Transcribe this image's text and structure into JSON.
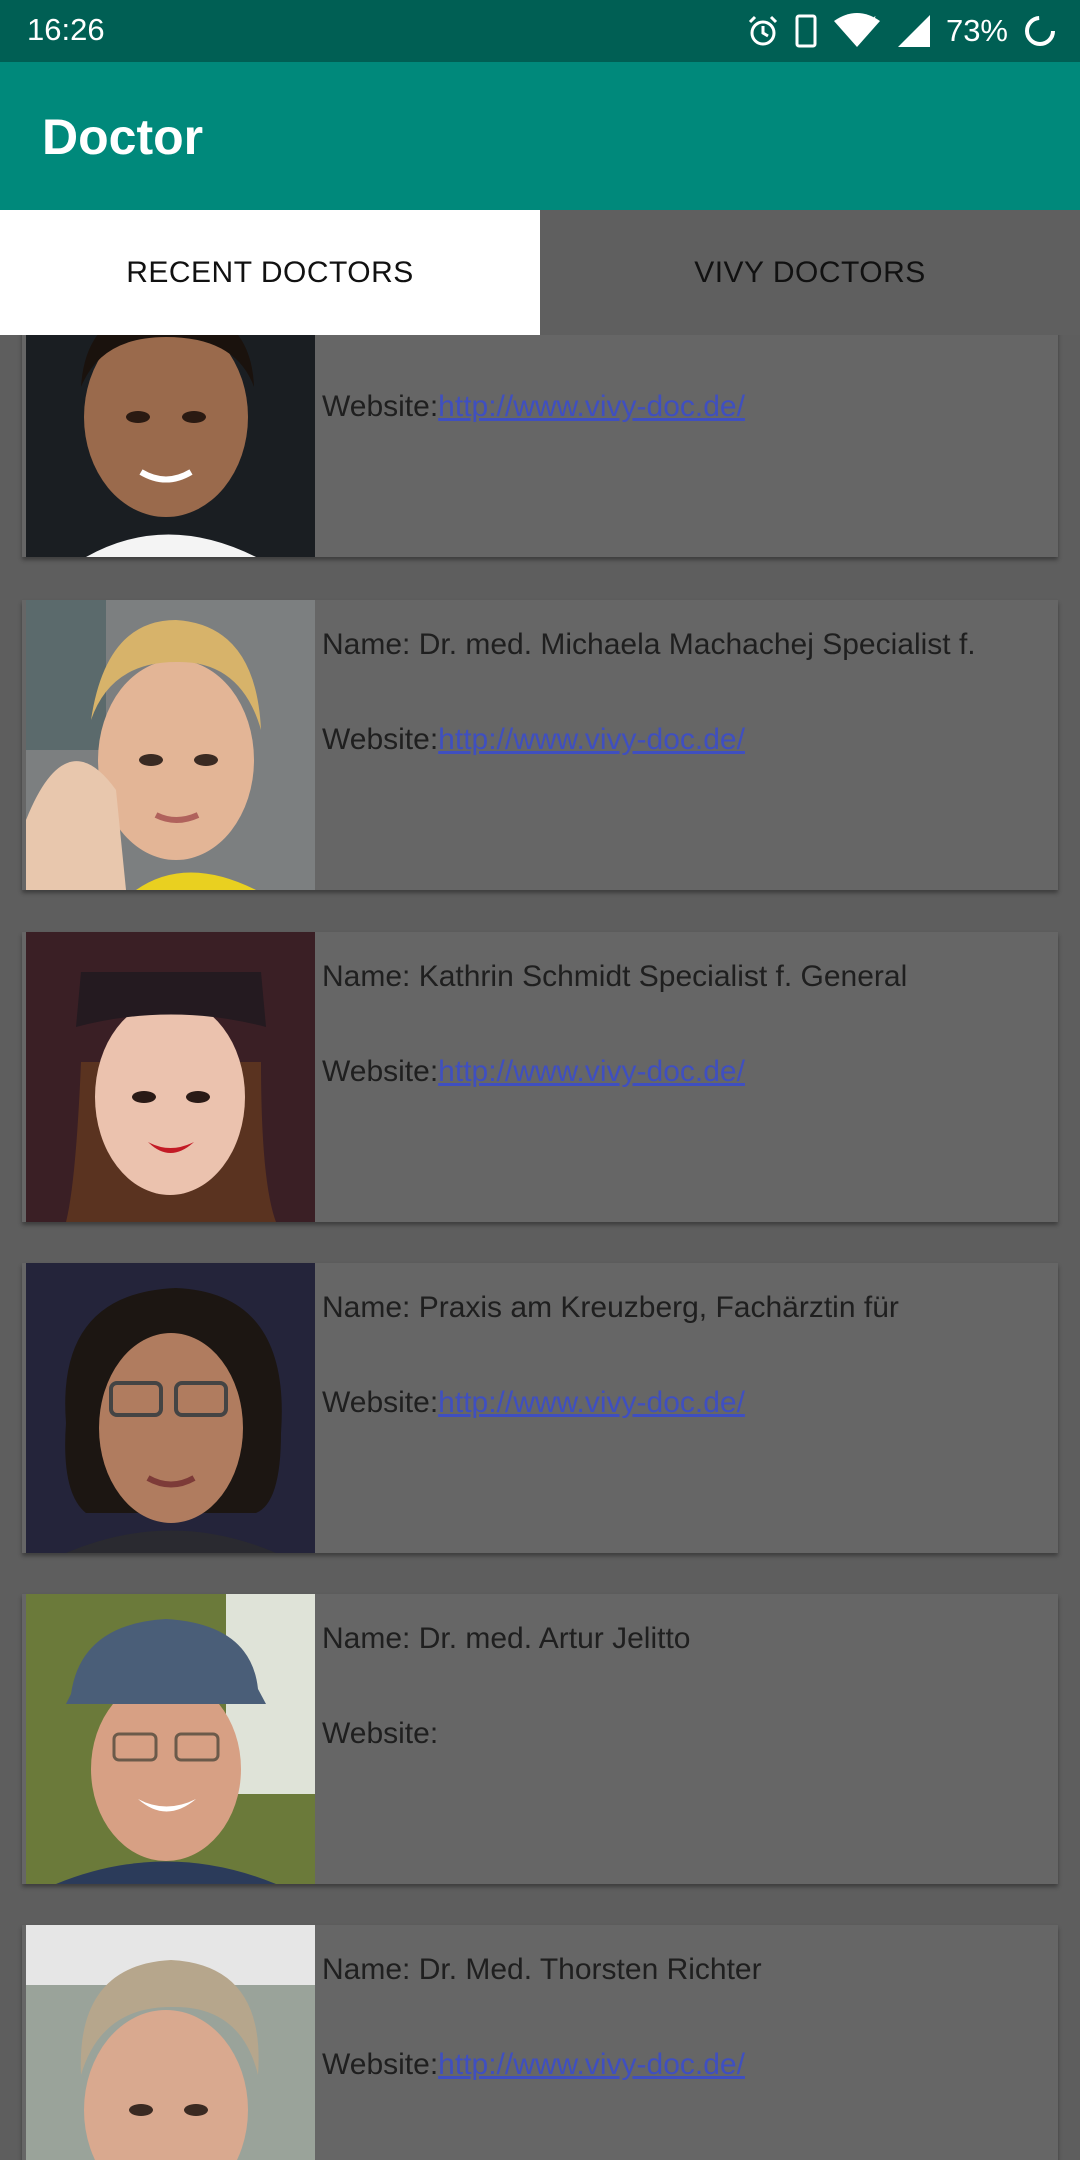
{
  "status_bar": {
    "time": "16:26",
    "battery": "73%"
  },
  "app_bar": {
    "title": "Doctor"
  },
  "tabs": [
    {
      "label": "RECENT DOCTORS",
      "selected": true
    },
    {
      "label": "VIVY DOCTORS",
      "selected": false
    }
  ],
  "doctors": [
    {
      "name_label": "",
      "name": "",
      "website_label": "Website:",
      "website": "http://www.vivy-doc.de/"
    },
    {
      "name_label": "Name: ",
      "name": "Dr. med. Michaela Machachej Specialist f.",
      "website_label": "Website:",
      "website": "http://www.vivy-doc.de/"
    },
    {
      "name_label": "Name: ",
      "name": "Kathrin Schmidt Specialist f. General",
      "website_label": "Website:",
      "website": "http://www.vivy-doc.de/"
    },
    {
      "name_label": "Name: ",
      "name": "Praxis am Kreuzberg, Fachärztin für",
      "website_label": "Website:",
      "website": "http://www.vivy-doc.de/"
    },
    {
      "name_label": "Name: ",
      "name": "Dr. med. Artur Jelitto",
      "website_label": "Website:",
      "website": ""
    },
    {
      "name_label": "Name: ",
      "name": "Dr. Med. Thorsten Richter",
      "website_label": "Website:",
      "website": "http://www.vivy-doc.de/"
    }
  ],
  "colors": {
    "status_bar": "#005f54",
    "app_bar": "#00897b",
    "list_background": "#5e5e5e",
    "card": "#666666",
    "link": "#3f4fc0"
  }
}
